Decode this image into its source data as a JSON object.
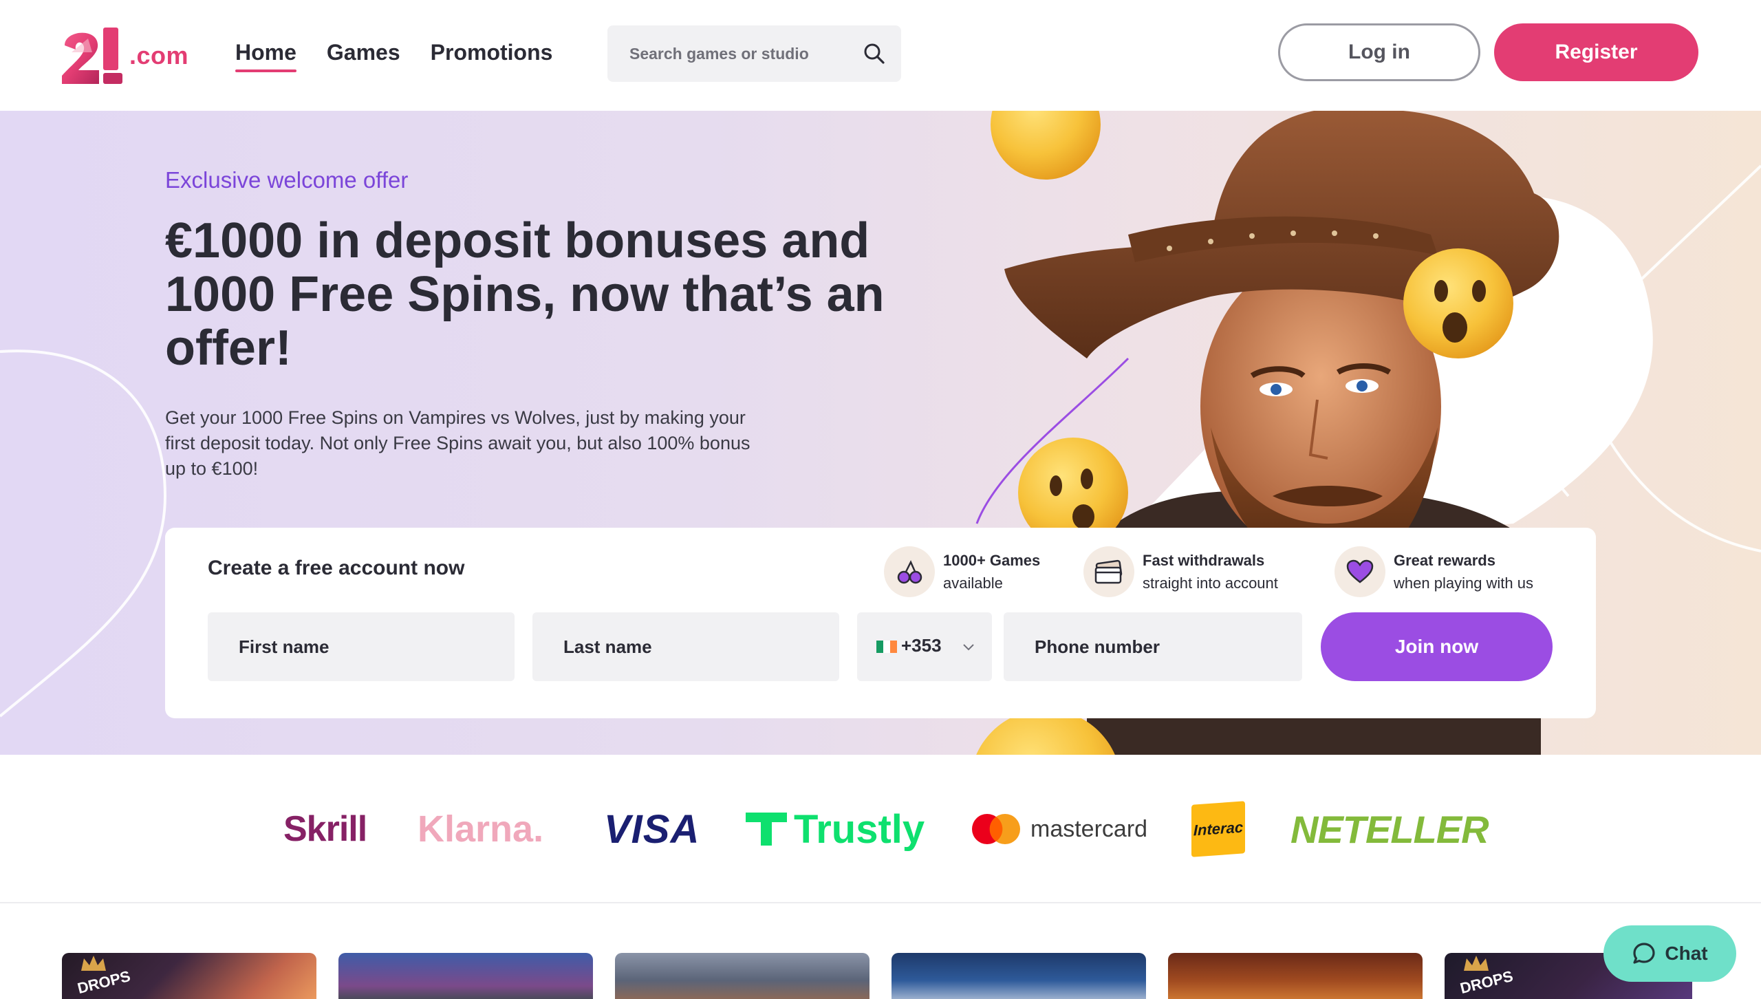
{
  "brand": {
    "logo_digits": "21",
    "suffix": ".com",
    "accent_color": "#e33d73",
    "purple_color": "#9b4de3"
  },
  "nav": {
    "items": [
      {
        "label": "Home",
        "active": true
      },
      {
        "label": "Games",
        "active": false
      },
      {
        "label": "Promotions",
        "active": false
      }
    ]
  },
  "search": {
    "placeholder": "Search games or studio",
    "icon": "search-icon"
  },
  "auth": {
    "login_label": "Log in",
    "register_label": "Register"
  },
  "hero": {
    "eyebrow": "Exclusive welcome offer",
    "headline": "€1000 in deposit bonuses and 1000 Free Spins, now that’s an offer!",
    "lead": "Get your 1000 Free Spins on Vampires vs Wolves, just by making your first deposit today. Not only Free Spins await you, but also 100% bonus up to €100!"
  },
  "signup": {
    "title": "Create a free account now",
    "features": [
      {
        "icon": "cherries-icon",
        "title": "1000+ Games",
        "subtitle": "available"
      },
      {
        "icon": "card-icon",
        "title": "Fast withdrawals",
        "subtitle": "straight into account"
      },
      {
        "icon": "heart-icon",
        "title": "Great rewards",
        "subtitle": "when playing with us"
      }
    ],
    "first_name_placeholder": "First name",
    "last_name_placeholder": "Last name",
    "country_code": "+353",
    "country_flag": "ireland-flag-icon",
    "phone_placeholder": "Phone number",
    "join_label": "Join now"
  },
  "payments": {
    "logos": [
      {
        "name": "Skrill",
        "color": "#862165"
      },
      {
        "name": "Klarna.",
        "color": "#f0a8bb"
      },
      {
        "name": "VISA",
        "color": "#1a1f71"
      },
      {
        "name": "Trustly",
        "color": "#0ee06e"
      },
      {
        "name": "mastercard",
        "color": "#3c3c3c"
      },
      {
        "name": "Interac",
        "color": "#fdb913"
      },
      {
        "name": "NETELLER",
        "color": "#83ba3b"
      }
    ]
  },
  "games": {
    "tile_tags": [
      "DROPS",
      "DROPS"
    ]
  },
  "chat": {
    "label": "Chat",
    "color": "#6fe0c9",
    "icon": "speech-bubble-icon"
  }
}
